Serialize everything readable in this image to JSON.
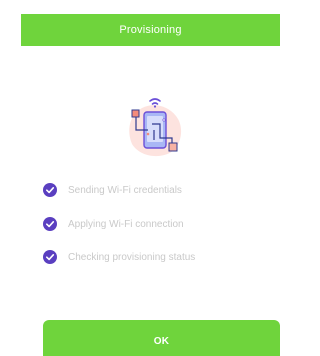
{
  "dialog": {
    "title": "Provisioning"
  },
  "illustration": {
    "icon": "phone-wifi-provisioning-illustration"
  },
  "steps": [
    {
      "label": "Sending Wi-Fi credentials",
      "done": true
    },
    {
      "label": "Applying Wi-Fi connection",
      "done": true
    },
    {
      "label": "Checking provisioning status",
      "done": true
    }
  ],
  "actions": {
    "ok_label": "OK"
  },
  "colors": {
    "accent": "#6fd43c",
    "check": "#5a3fc0",
    "muted_text": "#c9c9c9",
    "blob": "#fde3df"
  }
}
